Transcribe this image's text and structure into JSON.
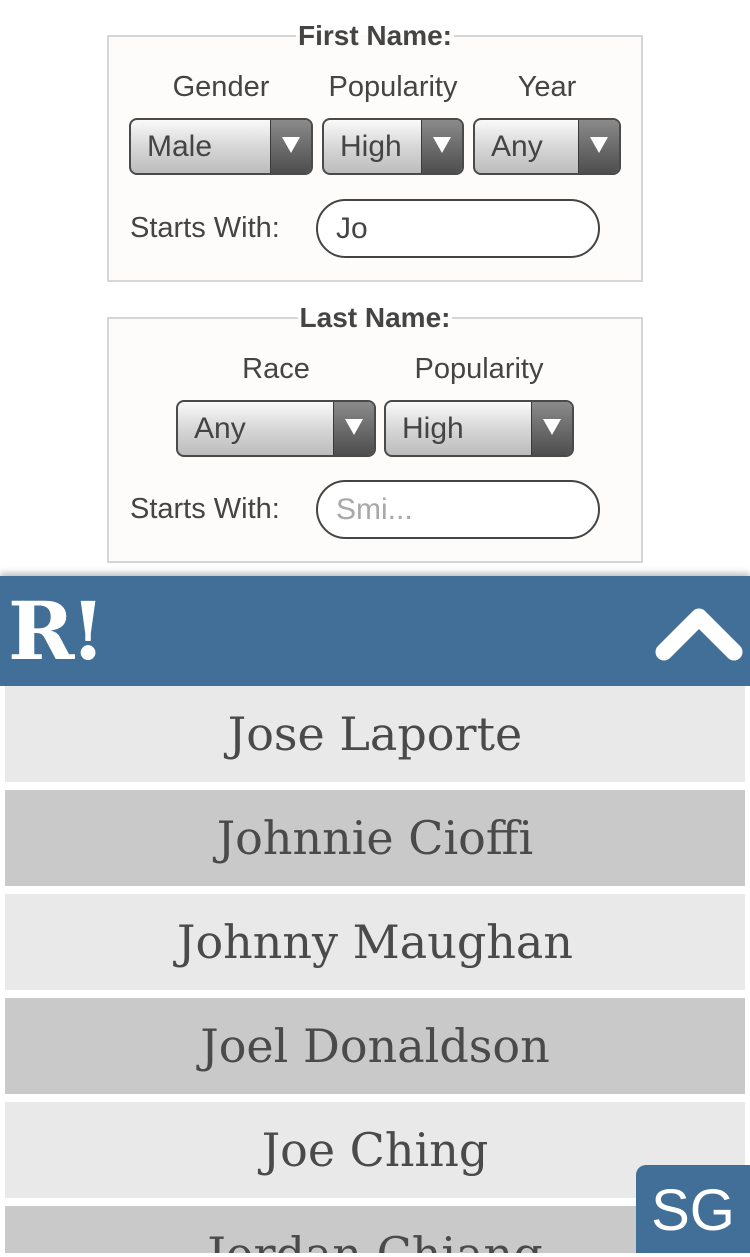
{
  "first_name": {
    "legend": "First Name:",
    "gender": {
      "label": "Gender",
      "value": "Male"
    },
    "popularity": {
      "label": "Popularity",
      "value": "High"
    },
    "year": {
      "label": "Year",
      "value": "Any"
    },
    "starts_with": {
      "label": "Starts With:",
      "value": "Jo"
    }
  },
  "last_name": {
    "legend": "Last Name:",
    "race": {
      "label": "Race",
      "value": "Any"
    },
    "popularity": {
      "label": "Popularity",
      "value": "High"
    },
    "starts_with": {
      "label": "Starts With:",
      "value": "",
      "placeholder": "Smi..."
    }
  },
  "header": {
    "logo": "R!",
    "collapse_icon": "chevron-up-icon",
    "color": "#416f97"
  },
  "results": [
    "Jose Laporte",
    "Johnnie Cioffi",
    "Johnny Maughan",
    "Joel Donaldson",
    "Joe Ching",
    "Jordan Chiang"
  ],
  "badge": {
    "label": "SG"
  }
}
